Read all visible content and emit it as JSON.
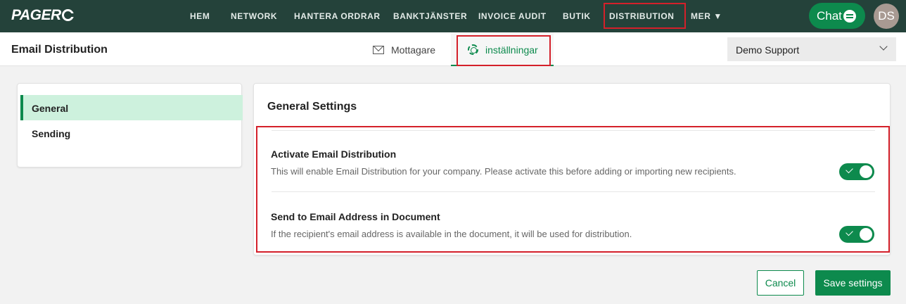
{
  "brand": {
    "name": "PAGER",
    "name_last": "O"
  },
  "nav": {
    "items": [
      {
        "label": "HEM"
      },
      {
        "label": "NETWORK"
      },
      {
        "label": "HANTERA ORDRAR"
      },
      {
        "label": "BANKTJÄNSTER"
      },
      {
        "label": "INVOICE AUDIT"
      },
      {
        "label": "BUTIK"
      },
      {
        "label": "DISTRIBUTION"
      },
      {
        "label": "MER ▼"
      }
    ],
    "chat_label": "Chat",
    "avatar_initials": "DS"
  },
  "subheader": {
    "page_title": "Email Distribution",
    "tabs": [
      {
        "label": "Mottagare",
        "icon": "mail-icon"
      },
      {
        "label": "inställningar",
        "icon": "gear-icon"
      }
    ],
    "company_select": {
      "value": "Demo Support"
    }
  },
  "sidebar": {
    "items": [
      {
        "label": "General"
      },
      {
        "label": "Sending"
      }
    ]
  },
  "panel": {
    "title": "General Settings",
    "settings": [
      {
        "title": "Activate Email Distribution",
        "description": "This will enable Email Distribution for your company. Please activate this before adding or importing new recipients.",
        "enabled": true
      },
      {
        "title": "Send to Email Address in Document",
        "description": "If the recipient's email address is available in the document, it will be used for distribution.",
        "enabled": true
      }
    ]
  },
  "actions": {
    "cancel_label": "Cancel",
    "save_label": "Save settings"
  },
  "colors": {
    "nav_bg": "#24423a",
    "accent": "#0d8a4d",
    "highlight": "#d4202a",
    "active_item_bg": "#cdf1dd"
  }
}
